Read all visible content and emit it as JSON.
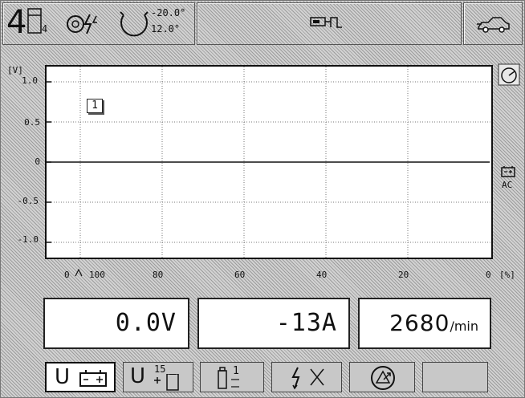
{
  "header": {
    "channel_number": "4",
    "menu_number": "4",
    "temperature_max": "-20.0°",
    "temperature_min": "12.0°"
  },
  "chart_data": {
    "type": "line",
    "y_unit": "[V]",
    "x_unit": "[%]",
    "y_tick_labels": [
      "1.0",
      "0.5",
      "0",
      "-0.5",
      "-1.0"
    ],
    "y_ticks": [
      1.0,
      0.5,
      0,
      -0.5,
      -1.0
    ],
    "x_tick_labels": [
      "100",
      "80",
      "60",
      "40",
      "20",
      "0"
    ],
    "x_ticks": [
      100,
      80,
      60,
      40,
      20,
      0
    ],
    "x_axis_zero_label": "0",
    "ylim": [
      -1.0,
      1.0
    ],
    "xlim": [
      100,
      0
    ],
    "grid": true,
    "series": [
      {
        "x": [
          100,
          0
        ],
        "values": [
          0,
          0
        ]
      }
    ],
    "curve_marker": "1"
  },
  "side": {
    "coupling_label": "AC"
  },
  "readouts": {
    "voltage": "0.0V",
    "current": "-13A",
    "rpm_value": "2680",
    "rpm_unit": "/min"
  },
  "buttons": {
    "voltage_battery_label": "U",
    "voltage_terminal_label": "U",
    "terminal_number": "15",
    "probe_number": "1"
  }
}
